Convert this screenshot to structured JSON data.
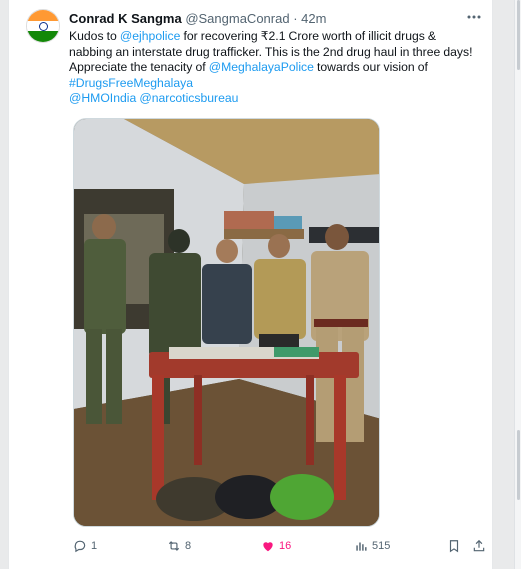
{
  "tweet": {
    "author_name": "Conrad K Sangma",
    "handle": "@SangmaConrad",
    "separator": "·",
    "time": "42m",
    "avatar_icon": "india-flag-avatar",
    "text": {
      "l1_a": "Kudos to ",
      "l1_link": "@ejhpolice",
      "l1_b": " for recovering ₹2.1 Crore worth of illicit drugs &",
      "l2": "nabbing an interstate drug trafficker. This is the 2nd drug haul in three days!",
      "l3_a": "Appreciate the tenacity of ",
      "l3_link": "@MeghalayaPolice",
      "l3_b": " towards our vision of",
      "l4_link": "#DrugsFreeMeghalaya",
      "l5_link1": "@HMOIndia",
      "l5_link2": "@narcoticsbureau"
    },
    "media_alt": "photo-police-with-seized-drugs",
    "actions": {
      "replies": "1",
      "reposts": "8",
      "likes": "16",
      "views": "515"
    }
  },
  "colors": {
    "link": "#1d9bf0",
    "like": "#f91880",
    "muted": "#536471"
  }
}
